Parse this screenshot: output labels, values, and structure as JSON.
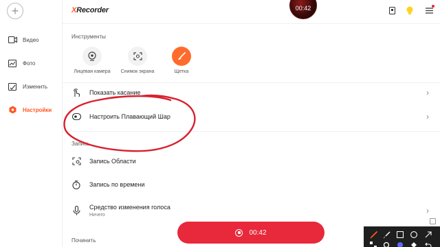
{
  "app": {
    "logo_x": "X",
    "logo_rest": "Recorder"
  },
  "floating_bubble": {
    "time": "00:42"
  },
  "sidebar": {
    "items": [
      {
        "label": "Видео",
        "icon": "video-icon"
      },
      {
        "label": "Фото",
        "icon": "image-icon"
      },
      {
        "label": "Изменить",
        "icon": "edit-icon"
      },
      {
        "label": "Настройки",
        "icon": "settings-icon",
        "active": true
      }
    ]
  },
  "tools": {
    "section_label": "Инструменты",
    "items": [
      {
        "label": "Лицевая камера",
        "icon": "webcam-icon"
      },
      {
        "label": "Снимок экрана",
        "icon": "screenshot-icon"
      },
      {
        "label": "Щетка",
        "icon": "brush-icon",
        "active": true
      }
    ]
  },
  "rows": {
    "show_touch": "Показать касание",
    "floating_ball": "Настроить Плавающий Шар",
    "record_section": "Запись",
    "area_record": "Запись Области",
    "timed_record": "Запись по времени",
    "voice_changer": "Средство изменения голоса",
    "voice_changer_value": "Ничего",
    "repair_section": "Починить"
  },
  "record_button": {
    "time": "00:42"
  },
  "colors": {
    "accent": "#ff5722",
    "record_red": "#e8283b",
    "annotation_red": "#d8202e"
  }
}
